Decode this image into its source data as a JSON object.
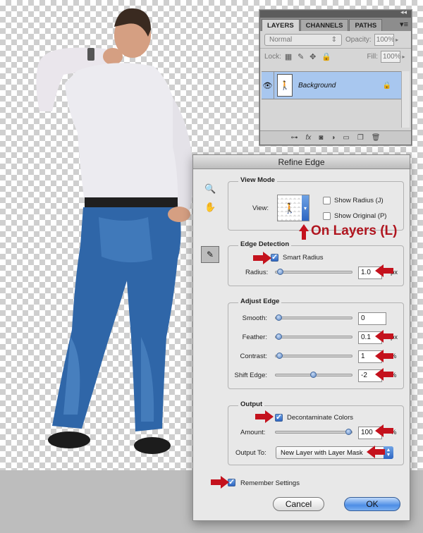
{
  "layers_panel": {
    "tabs": [
      "LAYERS",
      "CHANNELS",
      "PATHS"
    ],
    "blend_mode": "Normal",
    "opacity_label": "Opacity:",
    "opacity_value": "100%",
    "lock_label": "Lock:",
    "fill_label": "Fill:",
    "fill_value": "100%",
    "layer_name": "Background",
    "bottom_icons": [
      "link-icon",
      "fx-icon",
      "mask-icon",
      "adjustment-icon",
      "folder-icon",
      "new-layer-icon",
      "trash-icon"
    ]
  },
  "dialog": {
    "title": "Refine Edge",
    "view_mode": {
      "title": "View Mode",
      "view_label": "View:",
      "show_radius": "Show Radius (J)",
      "show_original": "Show Original (P)"
    },
    "edge_detection": {
      "title": "Edge Detection",
      "smart_radius": "Smart Radius",
      "radius_label": "Radius:",
      "radius_value": "1.0",
      "radius_unit": "px",
      "radius_level": 0.02
    },
    "adjust_edge": {
      "title": "Adjust Edge",
      "rows": [
        {
          "label": "Smooth:",
          "value": "0",
          "unit": "",
          "level": 0.0
        },
        {
          "label": "Feather:",
          "value": "0.1",
          "unit": "px",
          "level": 0.0
        },
        {
          "label": "Contrast:",
          "value": "1",
          "unit": "%",
          "level": 0.01
        },
        {
          "label": "Shift Edge:",
          "value": "-2",
          "unit": "%",
          "level": 0.49
        }
      ]
    },
    "output": {
      "title": "Output",
      "decontaminate": "Decontaminate Colors",
      "amount_label": "Amount:",
      "amount_value": "100",
      "amount_unit": "%",
      "amount_level": 1.0,
      "output_to_label": "Output To:",
      "output_to_value": "New Layer with Layer Mask"
    },
    "remember": "Remember Settings",
    "cancel": "Cancel",
    "ok": "OK"
  },
  "annotation": {
    "text": "On Layers (L)",
    "color": "#b0151f"
  }
}
